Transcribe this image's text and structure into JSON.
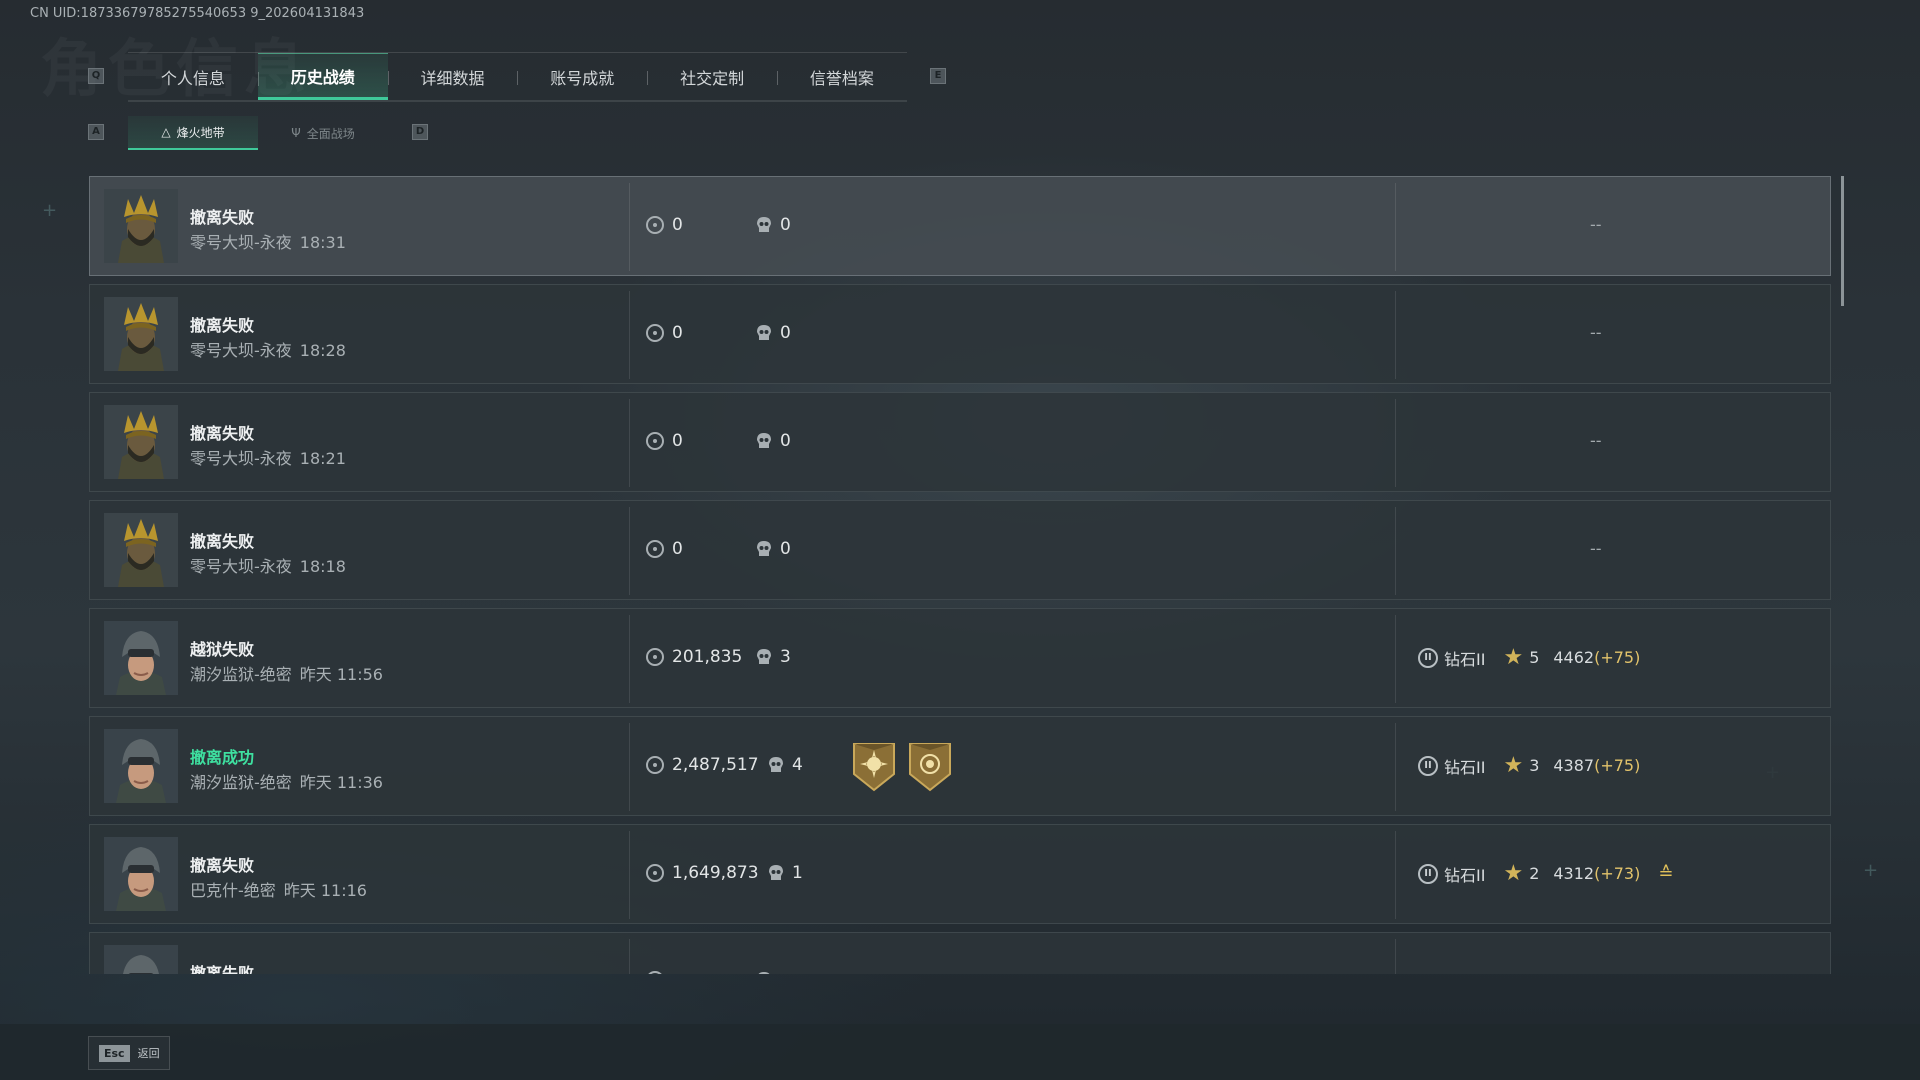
{
  "uid_text": "CN UID:18733679785275540653 9_202604131843",
  "bg_title": "角色信息",
  "keys": {
    "tab_prev": "Q",
    "tab_next": "E",
    "sub_prev": "A",
    "sub_next": "D"
  },
  "tabs": [
    {
      "label": "个人信息",
      "active": false
    },
    {
      "label": "历史战绩",
      "active": true
    },
    {
      "label": "详细数据",
      "active": false
    },
    {
      "label": "账号成就",
      "active": false
    },
    {
      "label": "社交定制",
      "active": false
    },
    {
      "label": "信誉档案",
      "active": false
    }
  ],
  "subtabs": [
    {
      "label": "烽火地带",
      "icon": "hazard-icon",
      "active": true
    },
    {
      "label": "全面战场",
      "icon": "battlefield-icon",
      "active": false
    }
  ],
  "records": [
    {
      "result": "撤离失败",
      "success": false,
      "map": "零号大坝-永夜",
      "time": "18:31",
      "value": "0",
      "kills": "0",
      "avatar": "crown-operator",
      "tier": "",
      "stars": "",
      "score": "",
      "delta": "",
      "empty": "--",
      "medals": [],
      "chevron": false
    },
    {
      "result": "撤离失败",
      "success": false,
      "map": "零号大坝-永夜",
      "time": "18:28",
      "value": "0",
      "kills": "0",
      "avatar": "crown-operator",
      "tier": "",
      "stars": "",
      "score": "",
      "delta": "",
      "empty": "--",
      "medals": [],
      "chevron": false
    },
    {
      "result": "撤离失败",
      "success": false,
      "map": "零号大坝-永夜",
      "time": "18:21",
      "value": "0",
      "kills": "0",
      "avatar": "crown-operator",
      "tier": "",
      "stars": "",
      "score": "",
      "delta": "",
      "empty": "--",
      "medals": [],
      "chevron": false
    },
    {
      "result": "撤离失败",
      "success": false,
      "map": "零号大坝-永夜",
      "time": "18:18",
      "value": "0",
      "kills": "0",
      "avatar": "crown-operator",
      "tier": "",
      "stars": "",
      "score": "",
      "delta": "",
      "empty": "--",
      "medals": [],
      "chevron": false
    },
    {
      "result": "越狱失败",
      "success": false,
      "map": "潮汐监狱-绝密",
      "time": "昨天 11:56",
      "value": "201,835",
      "kills": "3",
      "avatar": "helmet-operator",
      "tier": "钻石II",
      "stars": "5",
      "score": "4462",
      "delta": "(+75)",
      "empty": "",
      "medals": [],
      "chevron": false
    },
    {
      "result": "撤离成功",
      "success": true,
      "map": "潮汐监狱-绝密",
      "time": "昨天 11:36",
      "value": "2,487,517",
      "kills": "4",
      "avatar": "helmet-operator",
      "tier": "钻石II",
      "stars": "3",
      "score": "4387",
      "delta": "(+75)",
      "empty": "",
      "medals": [
        "sun-medal-icon",
        "shield-medal-icon"
      ],
      "chevron": false
    },
    {
      "result": "撤离失败",
      "success": false,
      "map": "巴克什-绝密",
      "time": "昨天 11:16",
      "value": "1,649,873",
      "kills": "1",
      "avatar": "helmet-operator",
      "tier": "钻石II",
      "stars": "2",
      "score": "4312",
      "delta": "(+73)",
      "empty": "",
      "medals": [],
      "chevron": true
    },
    {
      "result": "撤离失败",
      "success": false,
      "map": "",
      "time": "",
      "value": "",
      "kills": "",
      "avatar": "helmet-operator",
      "tier": "",
      "stars": "",
      "score": "",
      "delta": "",
      "empty": "",
      "medals": [],
      "chevron": false
    }
  ],
  "footer": {
    "esc_key": "Esc",
    "esc_label": "返回"
  },
  "colors": {
    "accent": "#3fc99a",
    "success": "#3ee0a0",
    "gold": "#e2c36b"
  }
}
